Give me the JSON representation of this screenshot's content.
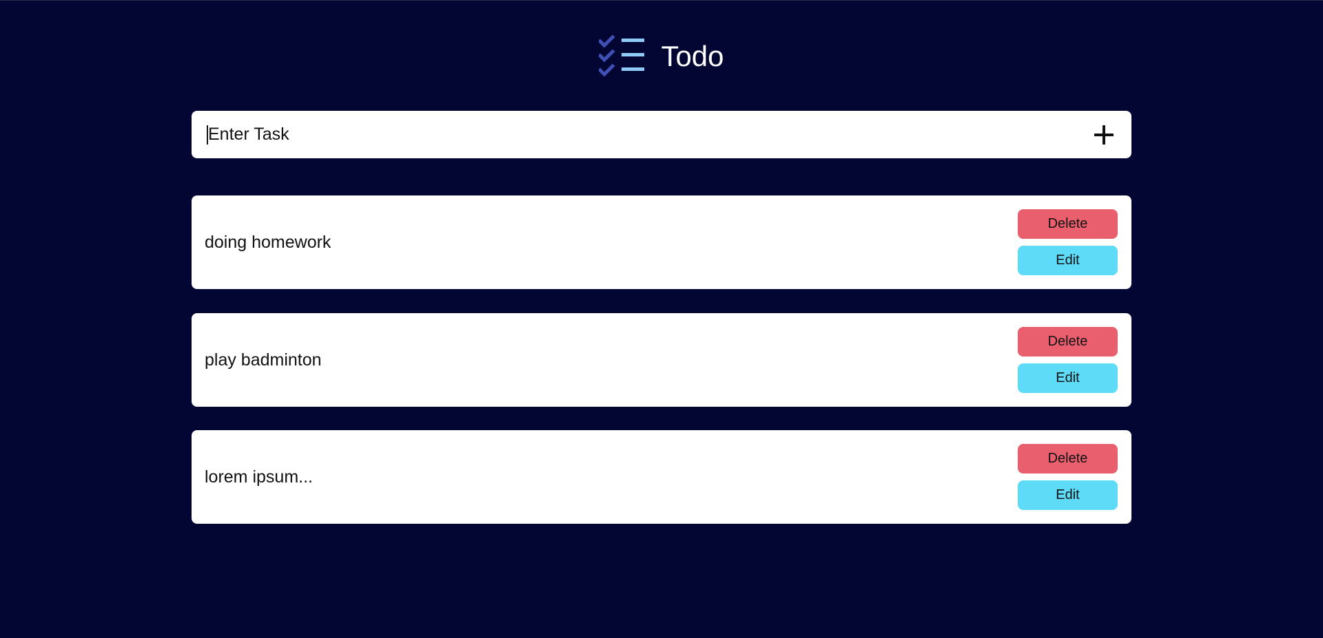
{
  "app": {
    "title": "Todo",
    "logo_icon": "checklist-icon"
  },
  "input": {
    "placeholder": "Enter Task",
    "value": "",
    "add_icon": "plus-icon"
  },
  "tasks": [
    {
      "text": "doing homework",
      "delete_label": "Delete",
      "edit_label": "Edit"
    },
    {
      "text": "play badminton",
      "delete_label": "Delete",
      "edit_label": "Edit"
    },
    {
      "text": "lorem ipsum...",
      "delete_label": "Delete",
      "edit_label": "Edit"
    }
  ],
  "colors": {
    "background": "#030533",
    "card": "#ffffff",
    "delete_button": "#e95f6d",
    "edit_button": "#5ddbf7",
    "logo_checks": "#3f51b5",
    "logo_lines": "#90caf9"
  }
}
